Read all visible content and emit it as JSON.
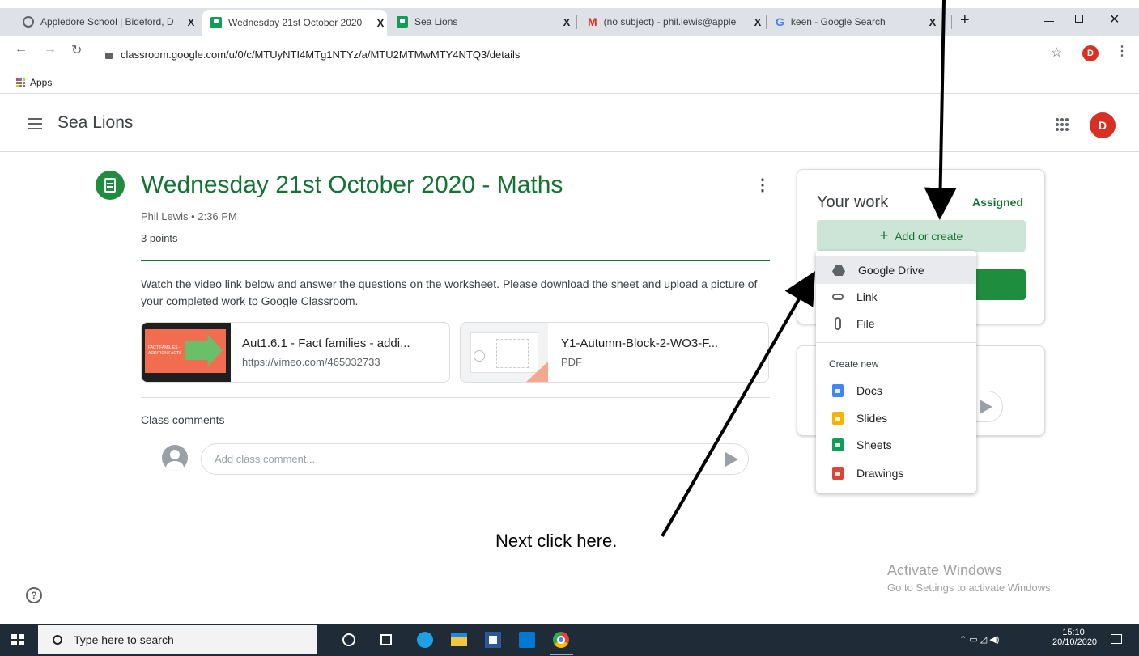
{
  "browser": {
    "tabs": [
      {
        "title": "Appledore School | Bideford, D",
        "icon": "globe-icon",
        "active": false
      },
      {
        "title": "Wednesday 21st October 2020",
        "icon": "classroom-icon",
        "active": true
      },
      {
        "title": "Sea Lions",
        "icon": "classroom-icon",
        "active": false
      },
      {
        "title": "(no subject) - phil.lewis@apple",
        "icon": "gmail-icon",
        "active": false
      },
      {
        "title": "keen - Google Search",
        "icon": "google-icon",
        "active": false
      }
    ],
    "close_glyph": "X",
    "new_tab": "+",
    "url": "classroom.google.com/u/0/c/MTUyNTI4MTg1NTYz/a/MTU2MTMwMTY4NTQ3/details",
    "bookmarks_label": "Apps",
    "profile_initial": "D"
  },
  "app": {
    "class_name": "Sea Lions",
    "user_initial": "D"
  },
  "assignment": {
    "title": "Wednesday 21st October 2020 - Maths",
    "meta": "Phil Lewis • 2:36 PM",
    "points": "3 points",
    "description": "Watch the video link below and answer the questions on the worksheet. Please download the sheet and upload a picture of your completed work to Google Classroom.",
    "attachments": [
      {
        "title": "Aut1.6.1 - Fact families - addi...",
        "subtitle": "https://vimeo.com/465032733",
        "thumb_text": "FACT FAMILIES - ADDITION FACTS"
      },
      {
        "title": "Y1-Autumn-Block-2-WO3-F...",
        "subtitle": "PDF"
      }
    ],
    "comments_heading": "Class comments",
    "comment_placeholder": "Add class comment..."
  },
  "your_work": {
    "heading": "Your work",
    "status": "Assigned",
    "add_button": "Add or create",
    "add_glyph": "+",
    "menu": {
      "items": [
        "Google Drive",
        "Link",
        "File"
      ],
      "create_new_heading": "Create new",
      "create_items": [
        "Docs",
        "Slides",
        "Sheets",
        "Drawings"
      ]
    }
  },
  "annotation": {
    "text": "Next click here."
  },
  "watermark": {
    "line1": "Activate Windows",
    "line2": "Go to Settings to activate Windows."
  },
  "taskbar": {
    "search_placeholder": "Type here to search",
    "time": "15:10",
    "date": "20/10/2020"
  },
  "colors": {
    "classroom_green": "#137333",
    "accent_button": "#1e8e3e",
    "add_button_bg": "#cde5d7",
    "taskbar": "#202b38"
  }
}
